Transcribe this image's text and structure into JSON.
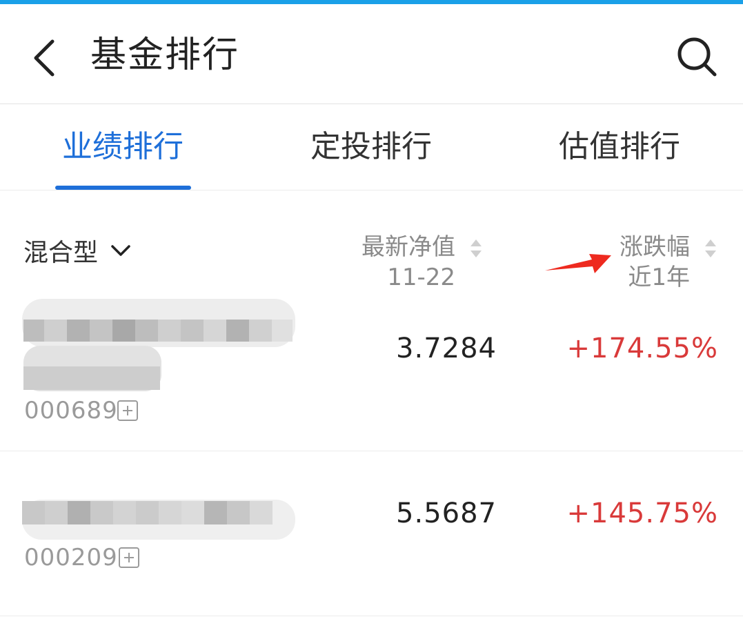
{
  "colors": {
    "accent": "#1e6fd9",
    "top_strip": "#1aa0e8",
    "gain": "#d93a3a",
    "muted": "#8a8a8a",
    "annotation_arrow": "#ee2a1f"
  },
  "header": {
    "title": "基金排行",
    "back_icon": "chevron-left-icon",
    "search_icon": "search-icon"
  },
  "tabs": [
    {
      "label": "业绩排行",
      "active": true
    },
    {
      "label": "定投排行",
      "active": false
    },
    {
      "label": "估值排行",
      "active": false
    }
  ],
  "filter": {
    "selected": "混合型",
    "icon": "chevron-down-icon"
  },
  "columns": {
    "nav": {
      "title": "最新净值",
      "subtitle": "11-22",
      "icon": "sort-icon"
    },
    "change": {
      "title": "涨跌幅",
      "subtitle": "近1年",
      "icon": "sort-icon"
    }
  },
  "funds": [
    {
      "code": "000689",
      "nav": "3.7284",
      "change": "+174.55%"
    },
    {
      "code": "000209",
      "nav": "5.5687",
      "change": "+145.75%"
    }
  ]
}
